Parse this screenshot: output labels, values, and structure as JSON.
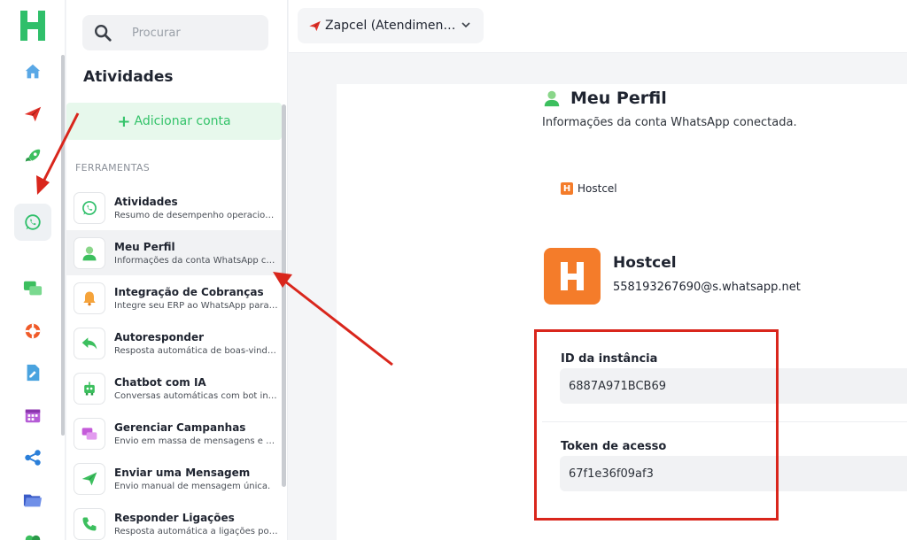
{
  "rail": {
    "icons": [
      "home-icon",
      "send-icon",
      "rocket-icon",
      "whatsapp-icon",
      "chat-icon",
      "support-icon",
      "document-icon",
      "calendar-icon",
      "share-icon",
      "folder-icon"
    ],
    "colors": {
      "brand": "#2fbf6a",
      "active_bg": "#eef1f4"
    }
  },
  "panel": {
    "search_placeholder": "Procurar",
    "title": "Atividades",
    "add_account_label": "Adicionar conta",
    "section_label": "FERRAMENTAS",
    "tools": [
      {
        "title": "Atividades",
        "desc": "Resumo de desempenho operacional e atividades",
        "icon": "whatsapp-icon"
      },
      {
        "title": "Meu Perfil",
        "desc": "Informações da conta WhatsApp conectada.",
        "icon": "user-icon"
      },
      {
        "title": "Integração de Cobranças",
        "desc": "Integre seu ERP ao WhatsApp para automatizar",
        "icon": "bell-icon"
      },
      {
        "title": "Autoresponder",
        "desc": "Resposta automática de boas-vindas e ausência",
        "icon": "reply-icon"
      },
      {
        "title": "Chatbot com IA",
        "desc": "Conversas automáticas com bot inteligente",
        "icon": "robot-icon"
      },
      {
        "title": "Gerenciar Campanhas",
        "desc": "Envio em massa de mensagens e anúncios",
        "icon": "campaign-icon"
      },
      {
        "title": "Enviar uma Mensagem",
        "desc": "Envio manual de mensagem única.",
        "icon": "send-icon"
      },
      {
        "title": "Responder Ligações",
        "desc": "Resposta automática a ligações por WhatsApp",
        "icon": "phone-icon"
      }
    ]
  },
  "topbar": {
    "account_label": "Zapcel (Atendimento)"
  },
  "profile": {
    "title": "Meu Perfil",
    "subtitle": "Informações da conta WhatsApp conectada.",
    "brand_name": "Hostcel",
    "account_name": "Hostcel",
    "account_phone": "558193267690@s.whatsapp.net",
    "instance_label": "ID da instância",
    "instance_value": "6887A971BCB69",
    "token_label": "Token de acesso",
    "token_value": "67f1e36f09af3"
  },
  "colors": {
    "accent_green": "#34c36a",
    "brand_orange": "#f47c2a",
    "annotation_red": "#d9261c"
  }
}
